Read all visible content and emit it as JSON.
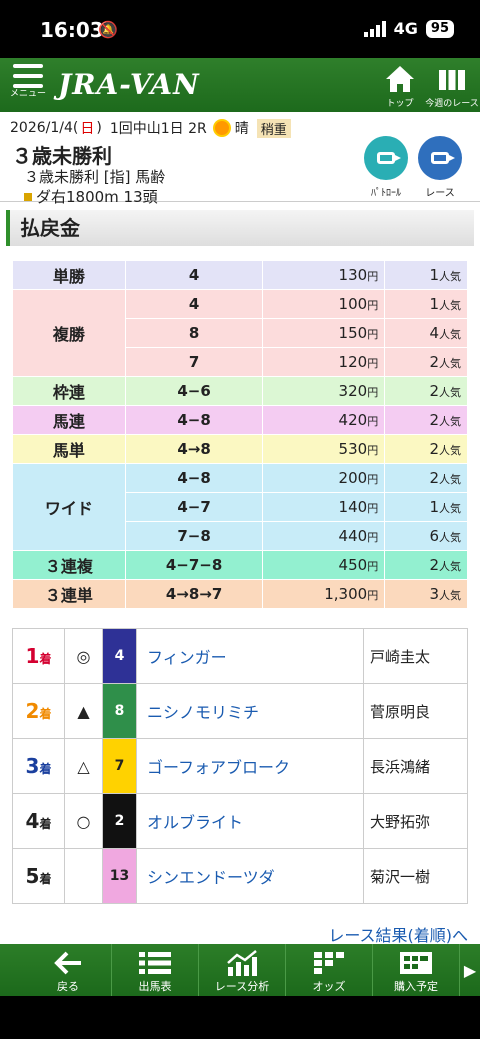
{
  "status": {
    "time": "16:03",
    "network": "4G",
    "battery": "95"
  },
  "header": {
    "menu_label": "メニュー",
    "logo": "JRA-VAN",
    "top_label": "トップ",
    "week_label": "今週のレース"
  },
  "race": {
    "date": "2026/1/4(",
    "day": "日",
    "date_end": ")",
    "meeting": "1回中山1日 2R",
    "weather": "晴",
    "going": "稍重",
    "title": "３歳未勝利",
    "subtitle": "３歳未勝利 [指] 馬齢",
    "course": "ダ右1800m 13頭",
    "patrol_label": "ﾊﾟﾄﾛｰﾙ",
    "race_label": "レース"
  },
  "section_title": "払戻金",
  "unit": "円",
  "pop_suffix": "人気",
  "payouts": [
    {
      "type": "単勝",
      "rows": [
        {
          "combo": "4",
          "amount": "130",
          "pop": "1"
        }
      ],
      "bg": "#e3e3f7"
    },
    {
      "type": "複勝",
      "rows": [
        {
          "combo": "4",
          "amount": "100",
          "pop": "1"
        },
        {
          "combo": "8",
          "amount": "150",
          "pop": "4"
        },
        {
          "combo": "7",
          "amount": "120",
          "pop": "2"
        }
      ],
      "bg": "#fcdcdc"
    },
    {
      "type": "枠連",
      "rows": [
        {
          "combo": "4−6",
          "amount": "320",
          "pop": "2"
        }
      ],
      "bg": "#dcf7d4"
    },
    {
      "type": "馬連",
      "rows": [
        {
          "combo": "4−8",
          "amount": "420",
          "pop": "2"
        }
      ],
      "bg": "#f4ccf2"
    },
    {
      "type": "馬単",
      "rows": [
        {
          "combo": "4→8",
          "amount": "530",
          "pop": "2"
        }
      ],
      "bg": "#fbf8c2"
    },
    {
      "type": "ワイド",
      "rows": [
        {
          "combo": "4−8",
          "amount": "200",
          "pop": "2"
        },
        {
          "combo": "4−7",
          "amount": "140",
          "pop": "1"
        },
        {
          "combo": "7−8",
          "amount": "440",
          "pop": "6"
        }
      ],
      "bg": "#c8ecf8"
    },
    {
      "type": "３連複",
      "rows": [
        {
          "combo": "4−7−8",
          "amount": "450",
          "pop": "2"
        }
      ],
      "bg": "#93f0d0"
    },
    {
      "type": "３連単",
      "rows": [
        {
          "combo": "4→8→7",
          "amount": "1,300",
          "pop": "3"
        }
      ],
      "bg": "#fbd9bd"
    }
  ],
  "results_suffix": "着",
  "results": [
    {
      "pos": "1",
      "pos_color": "#d40030",
      "mark": "◎",
      "num": "4",
      "num_bg": "#2e3196",
      "num_fg": "#fff",
      "horse": "フィンガー",
      "jockey": "戸崎圭太"
    },
    {
      "pos": "2",
      "pos_color": "#f08a00",
      "mark": "▲",
      "num": "8",
      "num_bg": "#2f8f4a",
      "num_fg": "#fff",
      "horse": "ニシノモリミチ",
      "jockey": "菅原明良"
    },
    {
      "pos": "3",
      "pos_color": "#1a3f9e",
      "mark": "△",
      "num": "7",
      "num_bg": "#ffd200",
      "num_fg": "#222",
      "horse": "ゴーフォアブローク",
      "jockey": "長浜鴻緒"
    },
    {
      "pos": "4",
      "pos_color": "#222",
      "mark": "○",
      "num": "2",
      "num_bg": "#111",
      "num_fg": "#fff",
      "horse": "オルブライト",
      "jockey": "大野拓弥"
    },
    {
      "pos": "5",
      "pos_color": "#222",
      "mark": "",
      "num": "13",
      "num_bg": "#f0a8e0",
      "num_fg": "#222",
      "horse": "シンエンドーツダ",
      "jockey": "菊沢一樹"
    }
  ],
  "more_link": "レース結果(着順)へ",
  "bottom_nav": [
    {
      "label": "戻る",
      "icon": "back-arrow-icon"
    },
    {
      "label": "出馬表",
      "icon": "list-icon"
    },
    {
      "label": "レース分析",
      "icon": "chart-icon"
    },
    {
      "label": "オッズ",
      "icon": "odds-icon"
    },
    {
      "label": "購入予定",
      "icon": "ticket-icon"
    }
  ]
}
